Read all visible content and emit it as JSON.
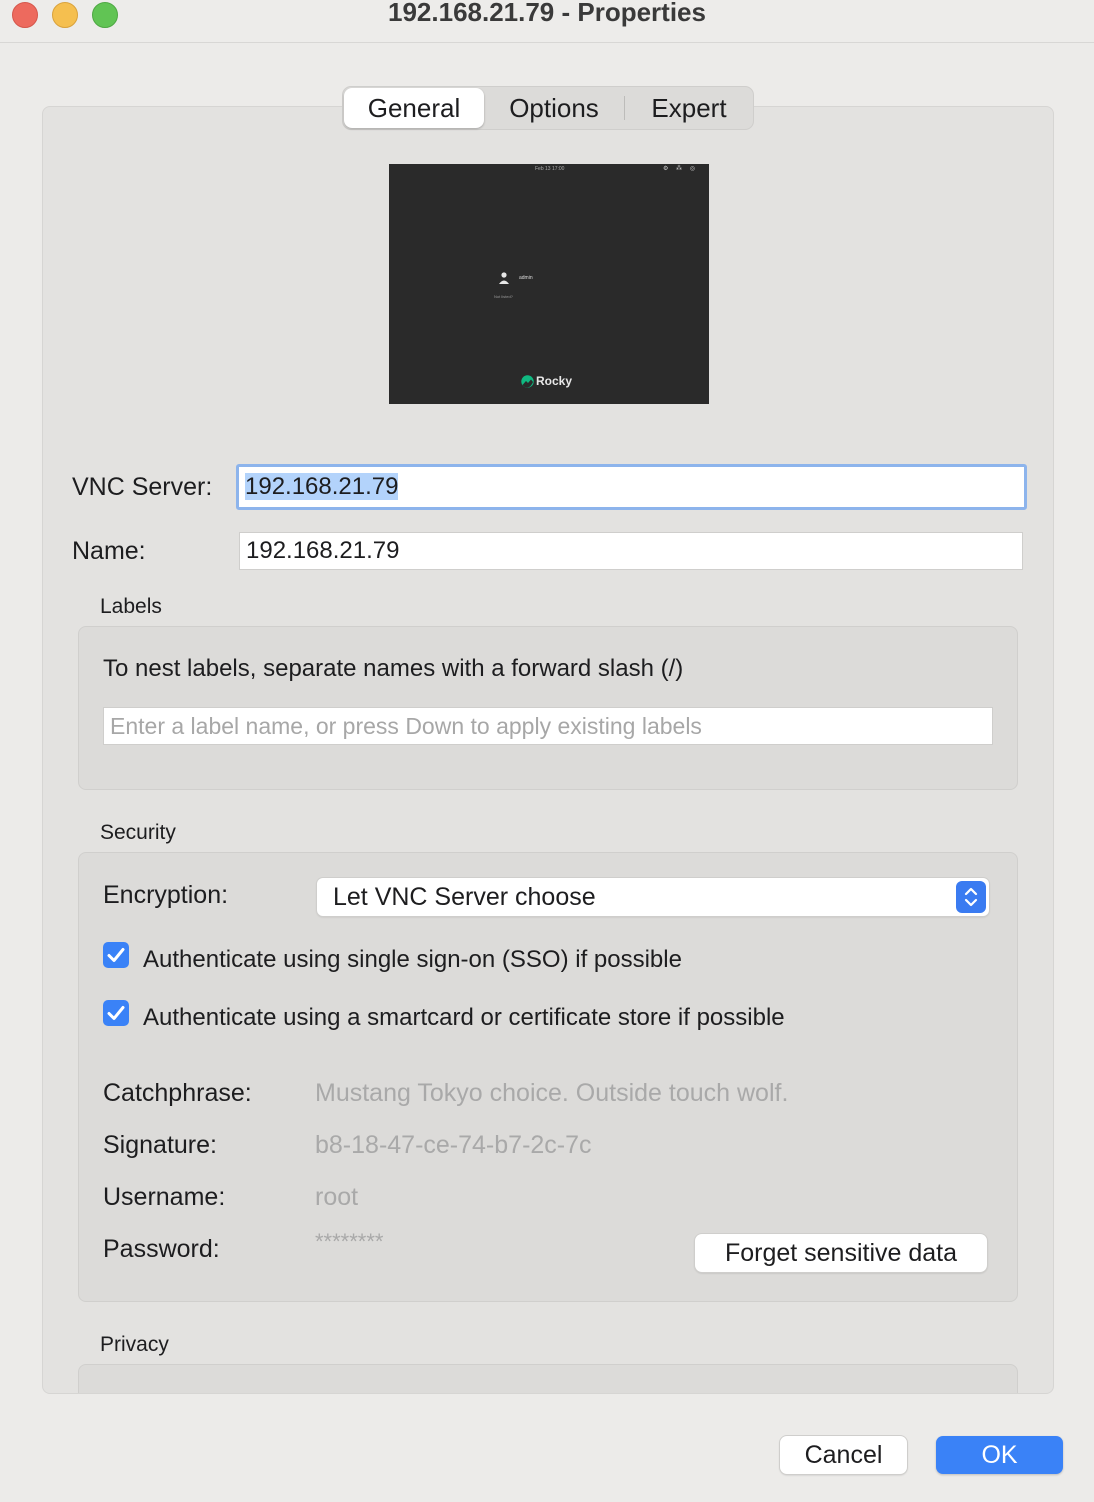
{
  "window": {
    "title": "192.168.21.79 - Properties"
  },
  "tabs": [
    "General",
    "Options",
    "Expert"
  ],
  "preview": {
    "clock": "Feb 13 17:00",
    "username": "admin",
    "hint": "Not listed?",
    "logo_text": "Rocky"
  },
  "form": {
    "vnc_server_label": "VNC Server:",
    "vnc_server_value": "192.168.21.79",
    "name_label": "Name:",
    "name_value": "192.168.21.79"
  },
  "labels_section": {
    "title": "Labels",
    "hint": "To nest labels, separate names with a forward slash (/)",
    "input_placeholder": "Enter a label name, or press Down to apply existing labels"
  },
  "security": {
    "title": "Security",
    "encryption_label": "Encryption:",
    "encryption_value": "Let VNC Server choose",
    "sso_label": "Authenticate using single sign-on (SSO) if possible",
    "sso_checked": true,
    "smartcard_label": "Authenticate using a smartcard or certificate store if possible",
    "smartcard_checked": true,
    "catchphrase_label": "Catchphrase:",
    "catchphrase_value": "Mustang Tokyo choice. Outside touch wolf.",
    "signature_label": "Signature:",
    "signature_value": "b8-18-47-ce-74-b7-2c-7c",
    "username_label": "Username:",
    "username_value": "root",
    "password_label": "Password:",
    "password_value": "********",
    "forget_button": "Forget sensitive data"
  },
  "privacy": {
    "title": "Privacy"
  },
  "footer": {
    "cancel": "Cancel",
    "ok": "OK"
  },
  "colors": {
    "accent": "#3a82f7",
    "focus_ring": "#8db4ec",
    "selection": "#b3d3fb"
  }
}
